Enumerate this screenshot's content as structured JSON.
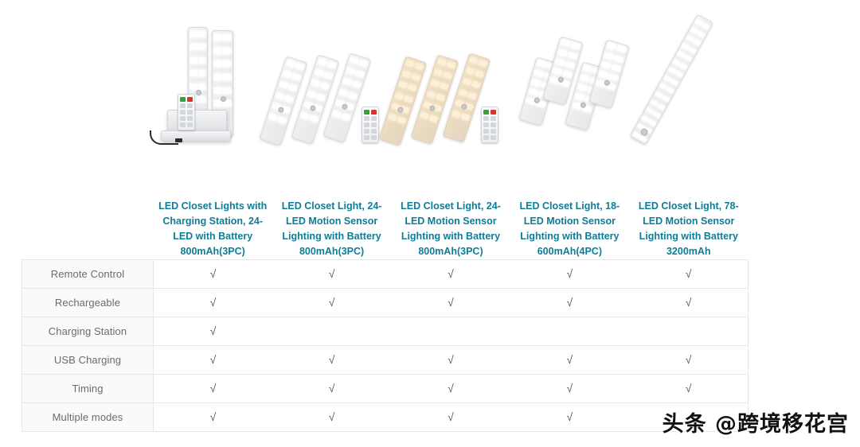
{
  "products": [
    {
      "id": "p1",
      "title": "LED Closet Lights with Charging Station, 24-LED with Battery 800mAh(3PC)",
      "image_name": "led-closet-lights-charging-station-3pack",
      "style": "white",
      "has_dock": true,
      "has_remote": true,
      "bar_count": 2,
      "orientation": "vertical"
    },
    {
      "id": "p2",
      "title": "LED Closet Light, 24-LED Motion Sensor Lighting with Battery 800mAh(3PC)",
      "image_name": "led-closet-light-24led-white-3pack",
      "style": "white",
      "has_dock": false,
      "has_remote": true,
      "bar_count": 3,
      "orientation": "tilted"
    },
    {
      "id": "p3",
      "title": "LED Closet Light, 24-LED Motion Sensor Lighting with Battery 800mAh(3PC)",
      "image_name": "led-closet-light-24led-warm-3pack",
      "style": "warm",
      "has_dock": false,
      "has_remote": true,
      "bar_count": 3,
      "orientation": "tilted"
    },
    {
      "id": "p4",
      "title": "LED Closet Light, 18-LED Motion Sensor Lighting with Battery 600mAh(4PC)",
      "image_name": "led-closet-light-18led-white-4pack",
      "style": "white",
      "has_dock": false,
      "has_remote": false,
      "bar_count": 4,
      "orientation": "tilted-short"
    },
    {
      "id": "p5",
      "title": "LED Closet Light, 78-LED Motion Sensor Lighting with Battery 3200mAh",
      "image_name": "led-closet-light-78led-long-bar",
      "style": "white",
      "has_dock": false,
      "has_remote": false,
      "bar_count": 1,
      "orientation": "diagonal-long"
    }
  ],
  "table": {
    "check_glyph": "√",
    "features": [
      {
        "label": "Remote Control",
        "name": "feature-remote-control",
        "values": [
          true,
          true,
          true,
          true,
          true
        ]
      },
      {
        "label": "Rechargeable",
        "name": "feature-rechargeable",
        "values": [
          true,
          true,
          true,
          true,
          true
        ]
      },
      {
        "label": "Charging Station",
        "name": "feature-charging-station",
        "values": [
          true,
          false,
          false,
          false,
          false
        ]
      },
      {
        "label": "USB Charging",
        "name": "feature-usb-charging",
        "values": [
          true,
          true,
          true,
          true,
          true
        ]
      },
      {
        "label": "Timing",
        "name": "feature-timing",
        "values": [
          true,
          true,
          true,
          true,
          true
        ]
      },
      {
        "label": "Multiple modes",
        "name": "feature-multiple-modes",
        "values": [
          true,
          true,
          true,
          true,
          false
        ]
      }
    ]
  },
  "watermark": {
    "text": "头条 @跨境移花宫"
  },
  "colors": {
    "title_link": "#0e7d97",
    "row_label_text": "#6b6b6b",
    "row_label_bg": "#fafafa",
    "border": "#e7e7e7",
    "check": "#4a5a6a"
  }
}
